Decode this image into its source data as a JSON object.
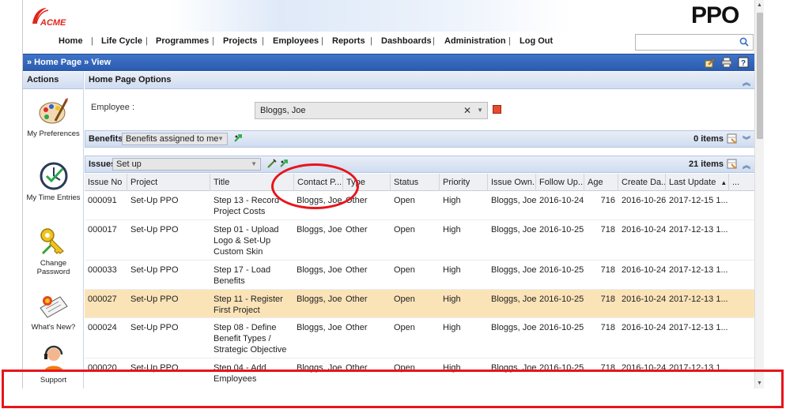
{
  "brand": {
    "left_logo": "ACME",
    "right_logo": "PPO"
  },
  "nav": {
    "items": [
      "Home",
      "Life Cycle",
      "Programmes",
      "Projects",
      "Employees",
      "Reports",
      "Dashboards",
      "Administration",
      "Log Out"
    ],
    "search_placeholder": ""
  },
  "breadcrumb": "» Home Page » View",
  "actions": {
    "title": "Actions",
    "items": [
      {
        "label": "My Preferences",
        "icon": "palette-icon"
      },
      {
        "label": "My Time Entries",
        "icon": "clock-icon"
      },
      {
        "label": "Change Password",
        "icon": "key-icon"
      },
      {
        "label": "What's New?",
        "icon": "newspaper-icon"
      },
      {
        "label": "Support",
        "icon": "headset-icon"
      }
    ]
  },
  "options": {
    "title": "Home Page Options",
    "employee_label": "Employee :",
    "employee_value": "Bloggs, Joe"
  },
  "benefits": {
    "title": "Benefits",
    "filter": "Benefits assigned to me",
    "count": "0 items"
  },
  "issues": {
    "title": "Issues",
    "filter": "Set up",
    "count": "21 items",
    "columns": [
      "Issue No",
      "Project",
      "Title",
      "Contact P...",
      "Type",
      "Status",
      "Priority",
      "Issue Own...",
      "Follow Up...",
      "Age",
      "Create Da...",
      "Last Update",
      "..."
    ],
    "sort_indicator": "▲",
    "rows": [
      {
        "no": "000091",
        "project": "Set-Up PPO",
        "title": "Step 13 - Record Project Costs",
        "contact": "Bloggs, Joe",
        "type": "Other",
        "status": "Open",
        "priority": "High",
        "owner": "Bloggs, Joe",
        "follow": "2016-10-24",
        "age": "716",
        "created": "2016-10-26",
        "updated": "2017-12-15 1..."
      },
      {
        "no": "000017",
        "project": "Set-Up PPO",
        "title": "Step 01 - Upload Logo & Set-Up Custom Skin",
        "contact": "Bloggs, Joe",
        "type": "Other",
        "status": "Open",
        "priority": "High",
        "owner": "Bloggs, Joe",
        "follow": "2016-10-25",
        "age": "718",
        "created": "2016-10-24",
        "updated": "2017-12-13 1..."
      },
      {
        "no": "000033",
        "project": "Set-Up PPO",
        "title": "Step 17 - Load Benefits",
        "contact": "Bloggs, Joe",
        "type": "Other",
        "status": "Open",
        "priority": "High",
        "owner": "Bloggs, Joe",
        "follow": "2016-10-25",
        "age": "718",
        "created": "2016-10-24",
        "updated": "2017-12-13 1..."
      },
      {
        "no": "000027",
        "project": "Set-Up PPO",
        "title": "Step 11 - Register First Project",
        "contact": "Bloggs, Joe",
        "type": "Other",
        "status": "Open",
        "priority": "High",
        "owner": "Bloggs, Joe",
        "follow": "2016-10-25",
        "age": "718",
        "created": "2016-10-24",
        "updated": "2017-12-13 1..."
      },
      {
        "no": "000024",
        "project": "Set-Up PPO",
        "title": "Step 08 - Define Benefit Types / Strategic Objective",
        "contact": "Bloggs, Joe",
        "type": "Other",
        "status": "Open",
        "priority": "High",
        "owner": "Bloggs, Joe",
        "follow": "2016-10-25",
        "age": "718",
        "created": "2016-10-24",
        "updated": "2017-12-13 1..."
      },
      {
        "no": "000020",
        "project": "Set-Up PPO",
        "title": "Step 04 - Add Employees",
        "contact": "Bloggs, Joe",
        "type": "Other",
        "status": "Open",
        "priority": "High",
        "owner": "Bloggs, Joe",
        "follow": "2016-10-25",
        "age": "718",
        "created": "2016-10-24",
        "updated": "2017-12-13 1..."
      }
    ]
  },
  "colors": {
    "accent_blue": "#2a5aae",
    "highlight_row": "#fbe3b8",
    "annotation_red": "#e8141b",
    "brand_red": "#e1251b"
  }
}
